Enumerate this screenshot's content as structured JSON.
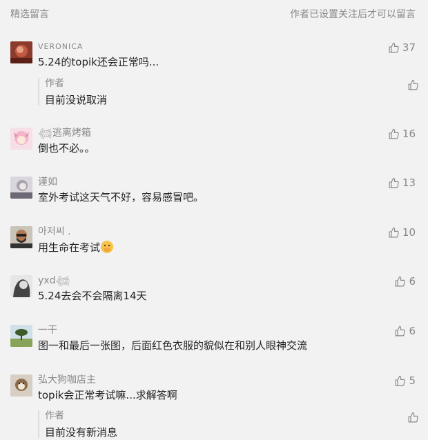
{
  "header": {
    "title": "精选留言",
    "note": "作者已设置关注后才可以留言"
  },
  "comments": [
    {
      "name": "VERONICA",
      "text": "5.24的topik还会正常吗...",
      "likes": "37",
      "avatar": "rose-portrait",
      "reply": {
        "author": "作者",
        "text": "目前没说取消"
      }
    },
    {
      "name": "𓆉逃离烤箱",
      "text": "倒也不必。。",
      "likes": "16",
      "avatar": "pink-anime"
    },
    {
      "name": "谨如",
      "text": "室外考试这天气不好，容易感冒吧。",
      "likes": "13",
      "avatar": "grey-portrait"
    },
    {
      "name": "아저씨 .",
      "text": "用生命在考试",
      "likes": "10",
      "avatar": "man-sunglasses",
      "emoji": "hand-over-mouth-face"
    },
    {
      "name": "yxd𓆉",
      "text": "5.24去会不会隔离14天",
      "likes": "6",
      "avatar": "girl-bw"
    },
    {
      "name": "一干",
      "text": "图一和最后一张图，后面红色衣服的貌似在和别人眼神交流",
      "likes": "6",
      "avatar": "tree-landscape"
    },
    {
      "name": "弘大狗咖店主",
      "text": "topik会正常考试嘛...求解答啊",
      "likes": "5",
      "avatar": "dog-cafe",
      "reply": {
        "author": "作者",
        "text": "目前没有新消息"
      }
    }
  ],
  "colors": {
    "background": "#f2f2f2",
    "meta": "#888888",
    "text": "#222222"
  },
  "icons": {
    "like": "thumbs-up-icon"
  }
}
